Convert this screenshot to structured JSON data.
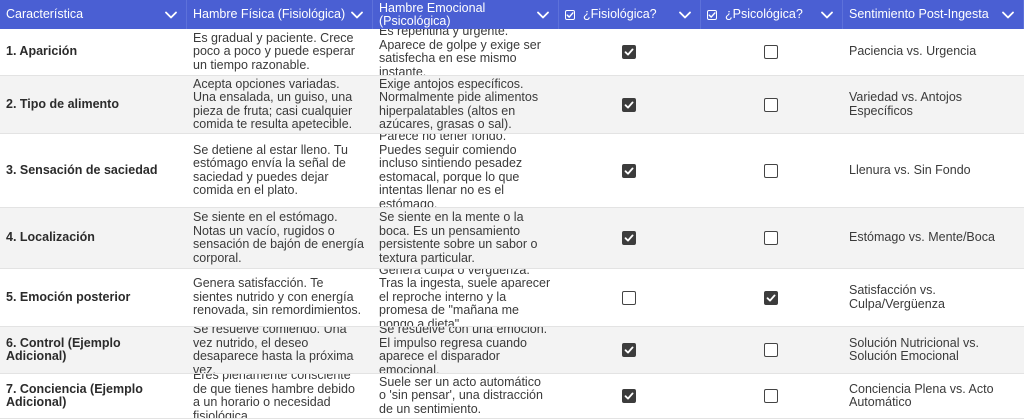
{
  "headers": [
    {
      "label": "Característica",
      "checkbox": false
    },
    {
      "label": "Hambre Física (Fisiológica)",
      "checkbox": false
    },
    {
      "label": "Hambre Emocional (Psicológica)",
      "checkbox": false
    },
    {
      "label": "¿Fisiológica?",
      "checkbox": true
    },
    {
      "label": "¿Psicológica?",
      "checkbox": true
    },
    {
      "label": "Sentimiento Post-Ingesta",
      "checkbox": false
    }
  ],
  "rows": [
    {
      "feature": "1. Aparición",
      "fisica": "Es gradual y paciente. Crece poco a poco y puede esperar un tiempo razonable.",
      "emocional": "Es repentina y urgente. Aparece de golpe y exige ser satisfecha en ese mismo instante.",
      "fisiologica": true,
      "psicologica": false,
      "post": "Paciencia vs. Urgencia"
    },
    {
      "feature": "2. Tipo de alimento",
      "fisica": "Acepta opciones variadas. Una ensalada, un guiso, una pieza de fruta; casi cualquier comida te resulta apetecible.",
      "emocional": "Exige antojos específicos. Normalmente pide alimentos hiperpalatables (altos en azúcares, grasas o sal).",
      "fisiologica": true,
      "psicologica": false,
      "post": "Variedad vs. Antojos Específicos"
    },
    {
      "feature": "3. Sensación de saciedad",
      "fisica": "Se detiene al estar lleno. Tu estómago envía la señal de saciedad y puedes dejar comida en el plato.",
      "emocional": "Parece no tener fondo. Puedes seguir comiendo incluso sintiendo pesadez estomacal, porque lo que intentas llenar no es el estómago.",
      "fisiologica": true,
      "psicologica": false,
      "post": "Llenura vs. Sin Fondo"
    },
    {
      "feature": "4. Localización",
      "fisica": "Se siente en el estómago. Notas un vacío, rugidos o sensación de bajón de energía corporal.",
      "emocional": "Se siente en la mente o la boca. Es un pensamiento persistente sobre un sabor o textura particular.",
      "fisiologica": true,
      "psicologica": false,
      "post": "Estómago vs. Mente/Boca"
    },
    {
      "feature": "5. Emoción posterior",
      "fisica": "Genera satisfacción. Te sientes nutrido y con energía renovada, sin remordimientos.",
      "emocional": "Genera culpa o vergüenza. Tras la ingesta, suele aparecer el reproche interno y la promesa de \"mañana me pongo a dieta\".",
      "fisiologica": false,
      "psicologica": true,
      "post": "Satisfacción vs. Culpa/Vergüenza"
    },
    {
      "feature": "6. Control (Ejemplo Adicional)",
      "fisica": "Se resuelve comiendo. Una vez nutrido, el deseo desaparece hasta la próxima vez.",
      "emocional": "Se resuelve con una emoción. El impulso regresa cuando aparece el disparador emocional.",
      "fisiologica": true,
      "psicologica": false,
      "post": "Solución Nutricional vs. Solución Emocional"
    },
    {
      "feature": "7. Conciencia (Ejemplo Adicional)",
      "fisica": "Eres plenamente consciente de que tienes hambre debido a un horario o necesidad fisiológica.",
      "emocional": "Suele ser un acto automático o 'sin pensar', una distracción de un sentimiento.",
      "fisiologica": true,
      "psicologica": false,
      "post": "Conciencia Plena vs. Acto Automático"
    }
  ]
}
